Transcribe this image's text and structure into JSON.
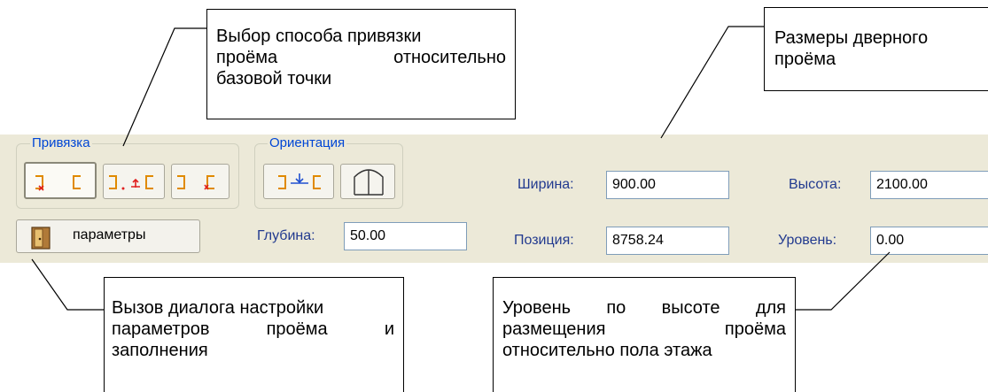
{
  "binding_group": {
    "legend": "Привязка",
    "buttons": [
      {
        "icon": "snap-left-icon",
        "pressed": true
      },
      {
        "icon": "snap-center-icon",
        "pressed": false
      },
      {
        "icon": "snap-right-icon",
        "pressed": false
      }
    ]
  },
  "orientation_group": {
    "legend": "Ориентация",
    "buttons": [
      {
        "icon": "orientation-flip-icon"
      },
      {
        "icon": "door-swing-icon"
      }
    ]
  },
  "params_button": {
    "label": "параметры",
    "icon": "door-icon"
  },
  "fields": {
    "depth": {
      "label": "Глубина:",
      "value": "50.00"
    },
    "width": {
      "label": "Ширина:",
      "value": "900.00"
    },
    "position": {
      "label": "Позиция:",
      "value": "8758.24"
    },
    "height": {
      "label": "Высота:",
      "value": "2100.00"
    },
    "level": {
      "label": "Уровень:",
      "value": "0.00"
    }
  },
  "callouts": {
    "binding": {
      "line1": "Выбор способа привязки",
      "line2_a": "проёма",
      "line2_b": "относительно",
      "line3": "базовой точки"
    },
    "dimensions": {
      "line1": "Размеры дверного",
      "line2": "проёма"
    },
    "params": {
      "line1": "Вызов диалога настройки",
      "line2_a": "параметров",
      "line2_b": "проёма",
      "line2_c": "и",
      "line3": "заполнения"
    },
    "level": {
      "line1_a": "Уровень",
      "line1_b": "по",
      "line1_c": "высоте",
      "line1_d": "для",
      "line2_a": "размещения",
      "line2_b": "проёма",
      "line3": "относительно пола этажа"
    }
  },
  "colors": {
    "toolbar_bg": "#ece9d8",
    "legend_text": "#0046d5",
    "label_text": "#223a8f",
    "icon_red": "#e02020",
    "icon_orange": "#e08a00",
    "icon_blue": "#2050d0"
  }
}
